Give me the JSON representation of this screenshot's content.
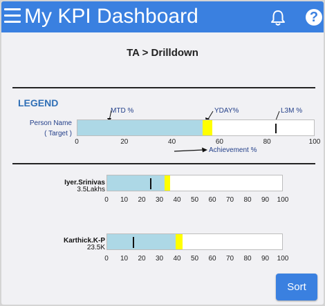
{
  "app": {
    "title": "My KPI Dashboard"
  },
  "icons": {
    "menu": "hamburger-menu-icon",
    "notifications": "bell-icon",
    "help": "question-mark-icon",
    "help_glyph": "?"
  },
  "colors": {
    "primary": "#3a80e0",
    "mtd": "#add8e6",
    "yday": "#ffff00",
    "l3m": "#111111",
    "legend_text": "#24408a"
  },
  "page": {
    "title": "TA > Drilldown"
  },
  "legend": {
    "title": "LEGEND",
    "person_label": "Person Name",
    "target_label": "( Target )",
    "mtd_label": "MTD %",
    "yday_label": "YDAY%",
    "l3m_label": "L3M %",
    "axis_label": "Achievement %",
    "mtd": 53,
    "yday": 4,
    "l3m": 84,
    "ticks": [
      "0",
      "20",
      "40",
      "60",
      "80",
      "100"
    ]
  },
  "people": [
    {
      "name": "Iyer.Srinivas",
      "target": "3.5Lakhs",
      "mtd": 33,
      "yday": 3,
      "l3m": 25,
      "ticks": [
        "0",
        "10",
        "20",
        "30",
        "40",
        "50",
        "60",
        "70",
        "80",
        "90",
        "100"
      ]
    },
    {
      "name": "Karthick.K-P",
      "target": "23.5K",
      "mtd": 39,
      "yday": 4,
      "l3m": 15,
      "ticks": [
        "0",
        "10",
        "20",
        "30",
        "40",
        "50",
        "60",
        "70",
        "80",
        "90",
        "100"
      ]
    }
  ],
  "actions": {
    "sort_label": "Sort"
  }
}
